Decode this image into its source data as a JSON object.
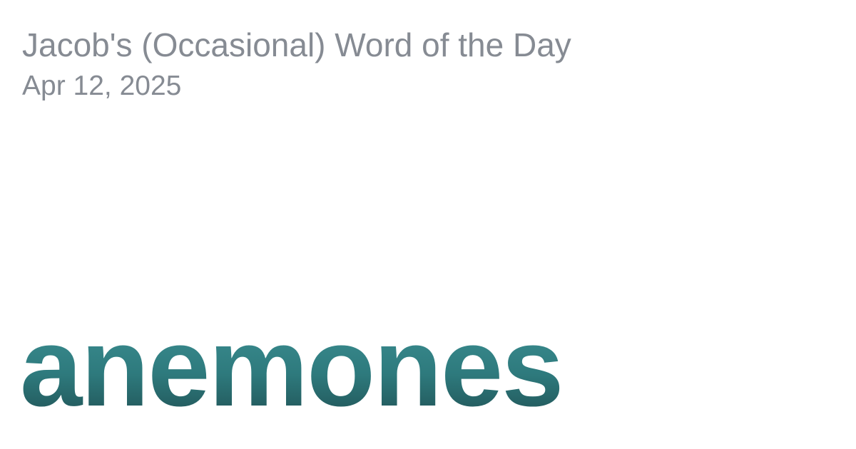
{
  "header": {
    "site_title": "Jacob's (Occasional) Word of the Day",
    "date": "Apr 12, 2025"
  },
  "main": {
    "word": "anemones"
  },
  "colors": {
    "meta_text": "#868b93",
    "word_gradient_top": "#3f9497",
    "word_gradient_bottom": "#1e4c4f",
    "background": "#ffffff"
  }
}
